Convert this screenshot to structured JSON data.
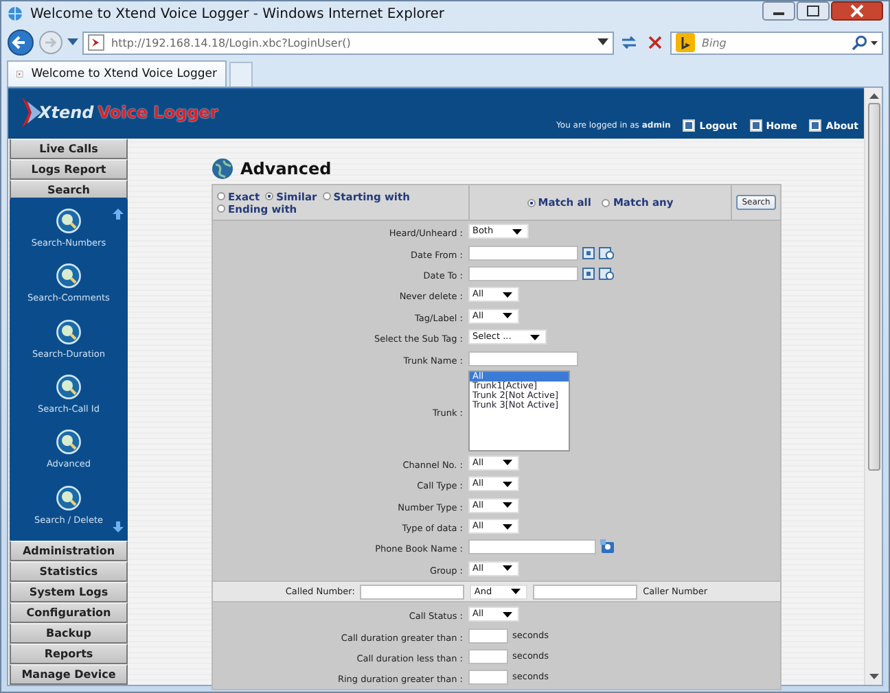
{
  "window": {
    "title": "Welcome to Xtend Voice Logger - Windows Internet Explorer"
  },
  "browser": {
    "address": "http://192.168.14.18/Login.xbc?LoginUser()",
    "search_placeholder": "Bing",
    "tab": "Welcome to Xtend Voice Logger"
  },
  "header": {
    "logo_brand": "Xtend",
    "logo_product": "Voice Logger",
    "logged_in": "You are logged in as **admin**",
    "links": [
      "Logout",
      "Home",
      "About"
    ]
  },
  "sidebar": {
    "items": [
      {
        "label": "Live Calls",
        "expanded": false
      },
      {
        "label": "Logs Report",
        "expanded": false
      },
      {
        "label": "Search",
        "expanded": true,
        "children": [
          "Search-Numbers",
          "Search-Comments",
          "Search-Duration",
          "Search-Call Id",
          "Advanced",
          "Search / Delete"
        ]
      },
      {
        "label": "Administration",
        "expanded": false
      },
      {
        "label": "Statistics",
        "expanded": false
      },
      {
        "label": "System Logs",
        "expanded": false
      },
      {
        "label": "Configuration",
        "expanded": false
      },
      {
        "label": "Backup",
        "expanded": false
      },
      {
        "label": "Reports",
        "expanded": false
      },
      {
        "label": "Manage Device",
        "expanded": false
      }
    ]
  },
  "page_title": "Advanced",
  "match_type": [
    {
      "label": "Exact",
      "selected": false
    },
    {
      "label": "Similar",
      "selected": true
    },
    {
      "label": "Starting with",
      "selected": false
    },
    {
      "label": "Ending with",
      "selected": false
    }
  ],
  "match_mode": [
    {
      "label": "Match all",
      "selected": true
    },
    {
      "label": "Match any",
      "selected": false
    }
  ],
  "search_button": "Search",
  "fields": [
    {
      "kind": "select",
      "label": "Heard/Unheard :",
      "value": "Both"
    },
    {
      "kind": "date",
      "label": "Date From :"
    },
    {
      "kind": "date",
      "label": "Date To :"
    },
    {
      "kind": "select",
      "label": "Never delete :",
      "value": "All"
    },
    {
      "kind": "select",
      "label": "Tag/Label :",
      "value": "All"
    },
    {
      "kind": "select",
      "label": "Select the Sub Tag :",
      "value": "Select ..."
    },
    {
      "kind": "text",
      "label": "Trunk Name :"
    },
    {
      "kind": "listbox",
      "label": "Trunk :",
      "options": [
        {
          "label": "All",
          "selected": true
        },
        {
          "label": "Trunk1[Active]",
          "selected": false
        },
        {
          "label": "Trunk 2[Not Active]",
          "selected": false
        },
        {
          "label": "Trunk 3[Not Active]",
          "selected": false
        }
      ]
    },
    {
      "kind": "select",
      "label": "Channel No. :",
      "value": "All"
    },
    {
      "kind": "select",
      "label": "Call Type :",
      "value": "All"
    },
    {
      "kind": "select",
      "label": "Number Type :",
      "value": "All"
    },
    {
      "kind": "select",
      "label": "Type of data :",
      "value": "All"
    },
    {
      "kind": "phonebook",
      "label": "Phone Book Name :"
    },
    {
      "kind": "select",
      "label": "Group :",
      "value": "All"
    },
    {
      "kind": "numbers",
      "label": "Called Number:",
      "operator": "And",
      "second_label": "Caller Number"
    },
    {
      "kind": "select",
      "label": "Call Status :",
      "value": "All"
    },
    {
      "kind": "seconds",
      "label": "Call duration greater than :",
      "unit": "seconds"
    },
    {
      "kind": "seconds",
      "label": "Call duration less than :",
      "unit": "seconds"
    },
    {
      "kind": "seconds",
      "label": "Ring duration greater than :",
      "unit": "seconds"
    }
  ]
}
